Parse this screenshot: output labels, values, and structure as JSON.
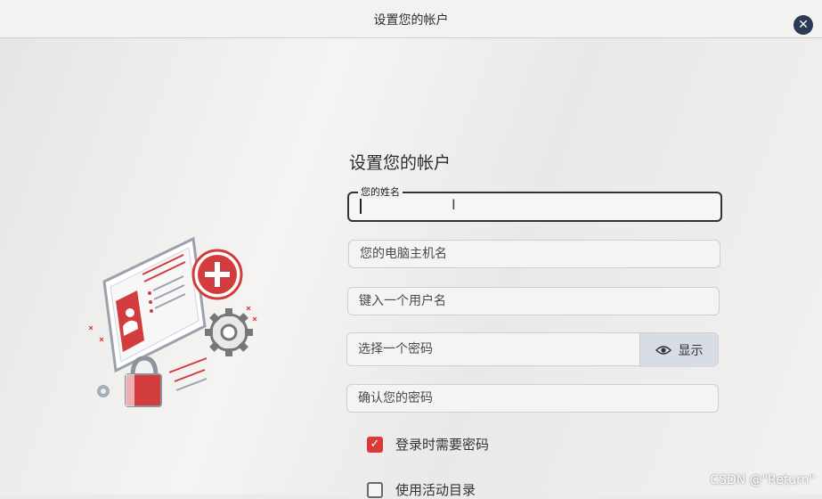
{
  "window": {
    "title": "设置您的帐户",
    "close_icon": "close-icon"
  },
  "form": {
    "heading": "设置您的帐户",
    "name_field": {
      "label": "您的姓名",
      "value": ""
    },
    "hostname_field": {
      "placeholder": "您的电脑主机名"
    },
    "username_field": {
      "placeholder": "键入一个用户名"
    },
    "password_field": {
      "placeholder": "选择一个密码",
      "show_label": "显示",
      "show_icon": "eye-icon"
    },
    "confirm_field": {
      "placeholder": "确认您的密码"
    },
    "require_password": {
      "label": "登录时需要密码",
      "checked": true
    },
    "active_directory": {
      "label": "使用活动目录",
      "checked": false
    }
  },
  "watermark": "CSDN @\"Return\"",
  "colors": {
    "accent": "#d93b3b",
    "close_button": "#2b3a55",
    "show_button_bg": "#d8dde5"
  }
}
